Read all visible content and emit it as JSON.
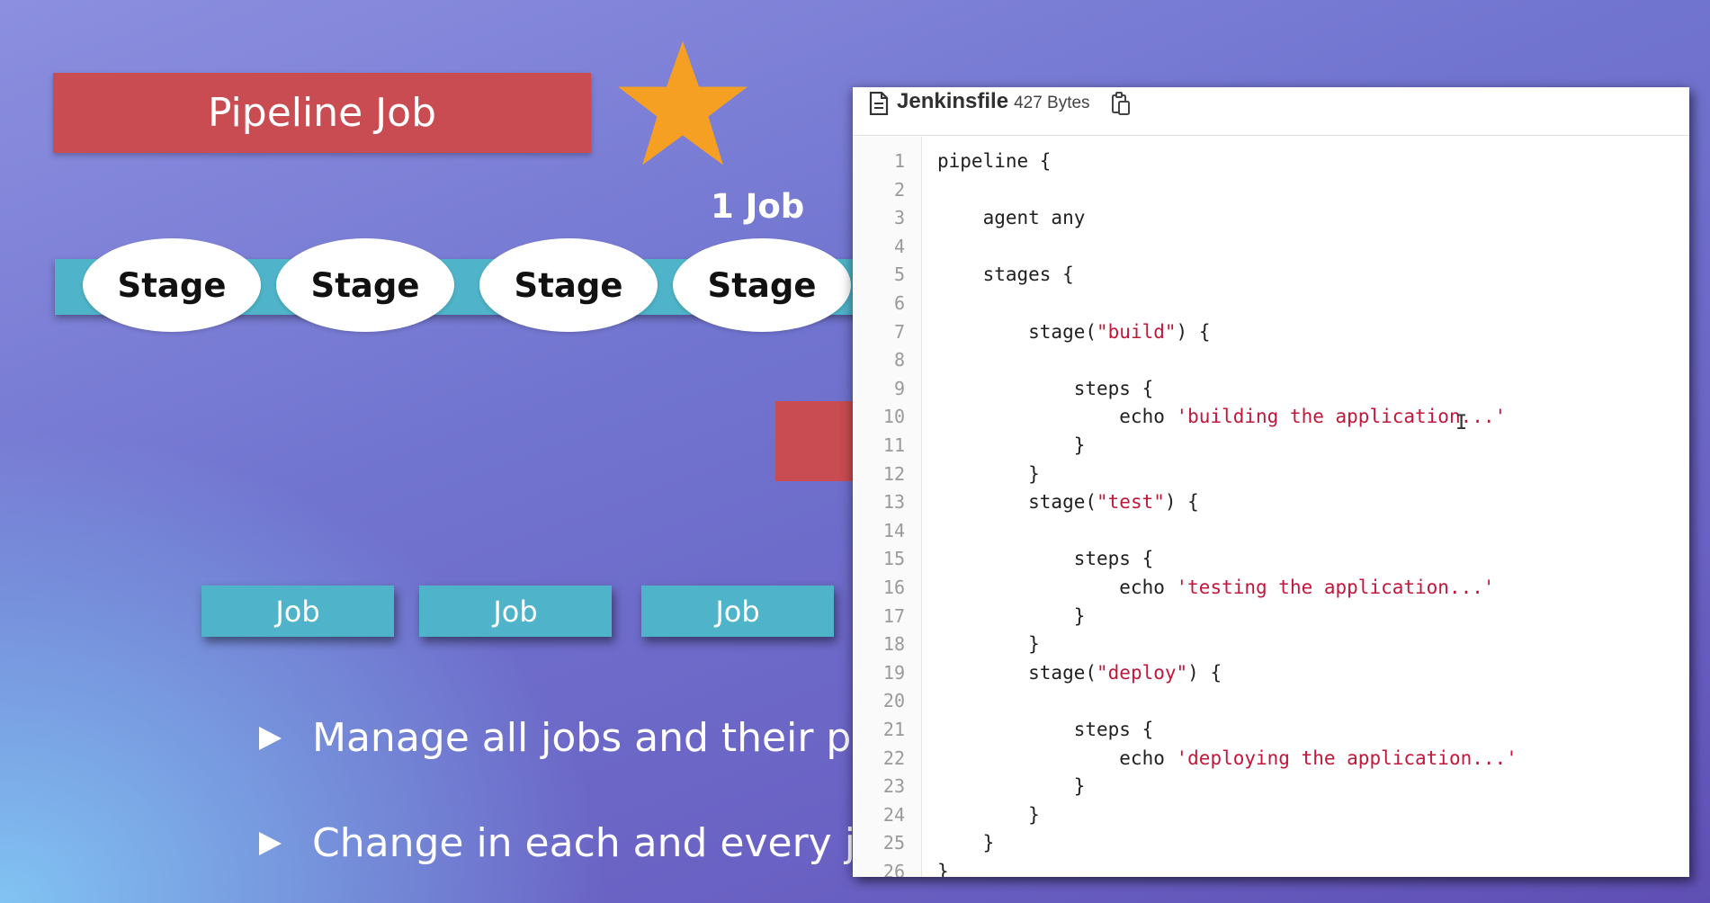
{
  "slide": {
    "title": "Pipeline Job",
    "one_job_label": "1 Job",
    "stages": [
      "Stage",
      "Stage",
      "Stage",
      "Stage"
    ],
    "jobs": [
      "Job",
      "Job",
      "Job"
    ],
    "bullets": [
      "Manage all jobs and their pl",
      "Change in each and every jo"
    ],
    "colors": {
      "red_box": "#c84c52",
      "teal": "#4fb4c9",
      "star": "#f5a022"
    }
  },
  "jenkinsfile": {
    "icon": "file-icon",
    "file_name": "Jenkinsfile",
    "file_size": "427 Bytes",
    "copy_icon": "copy-icon",
    "lines": [
      {
        "n": "1",
        "code": "pipeline {",
        "str": ""
      },
      {
        "n": "2",
        "code": "",
        "str": ""
      },
      {
        "n": "3",
        "code": "    agent any",
        "str": ""
      },
      {
        "n": "4",
        "code": "",
        "str": ""
      },
      {
        "n": "5",
        "code": "    stages {",
        "str": ""
      },
      {
        "n": "6",
        "code": "",
        "str": ""
      },
      {
        "n": "7",
        "code": "        stage(",
        "str": "\"build\"",
        "after": ") {"
      },
      {
        "n": "8",
        "code": "",
        "str": ""
      },
      {
        "n": "9",
        "code": "            steps {",
        "str": ""
      },
      {
        "n": "10",
        "code": "                echo ",
        "str": "'building the application...'"
      },
      {
        "n": "11",
        "code": "            }",
        "str": ""
      },
      {
        "n": "12",
        "code": "        }",
        "str": ""
      },
      {
        "n": "13",
        "code": "        stage(",
        "str": "\"test\"",
        "after": ") {"
      },
      {
        "n": "14",
        "code": "",
        "str": ""
      },
      {
        "n": "15",
        "code": "            steps {",
        "str": ""
      },
      {
        "n": "16",
        "code": "                echo ",
        "str": "'testing the application...'"
      },
      {
        "n": "17",
        "code": "            }",
        "str": ""
      },
      {
        "n": "18",
        "code": "        }",
        "str": ""
      },
      {
        "n": "19",
        "code": "        stage(",
        "str": "\"deploy\"",
        "after": ") {"
      },
      {
        "n": "20",
        "code": "",
        "str": ""
      },
      {
        "n": "21",
        "code": "            steps {",
        "str": ""
      },
      {
        "n": "22",
        "code": "                echo ",
        "str": "'deploying the application...'"
      },
      {
        "n": "23",
        "code": "            }",
        "str": ""
      },
      {
        "n": "24",
        "code": "        }",
        "str": ""
      },
      {
        "n": "25",
        "code": "    }",
        "str": ""
      },
      {
        "n": "26",
        "code": "}",
        "str": ""
      }
    ]
  }
}
